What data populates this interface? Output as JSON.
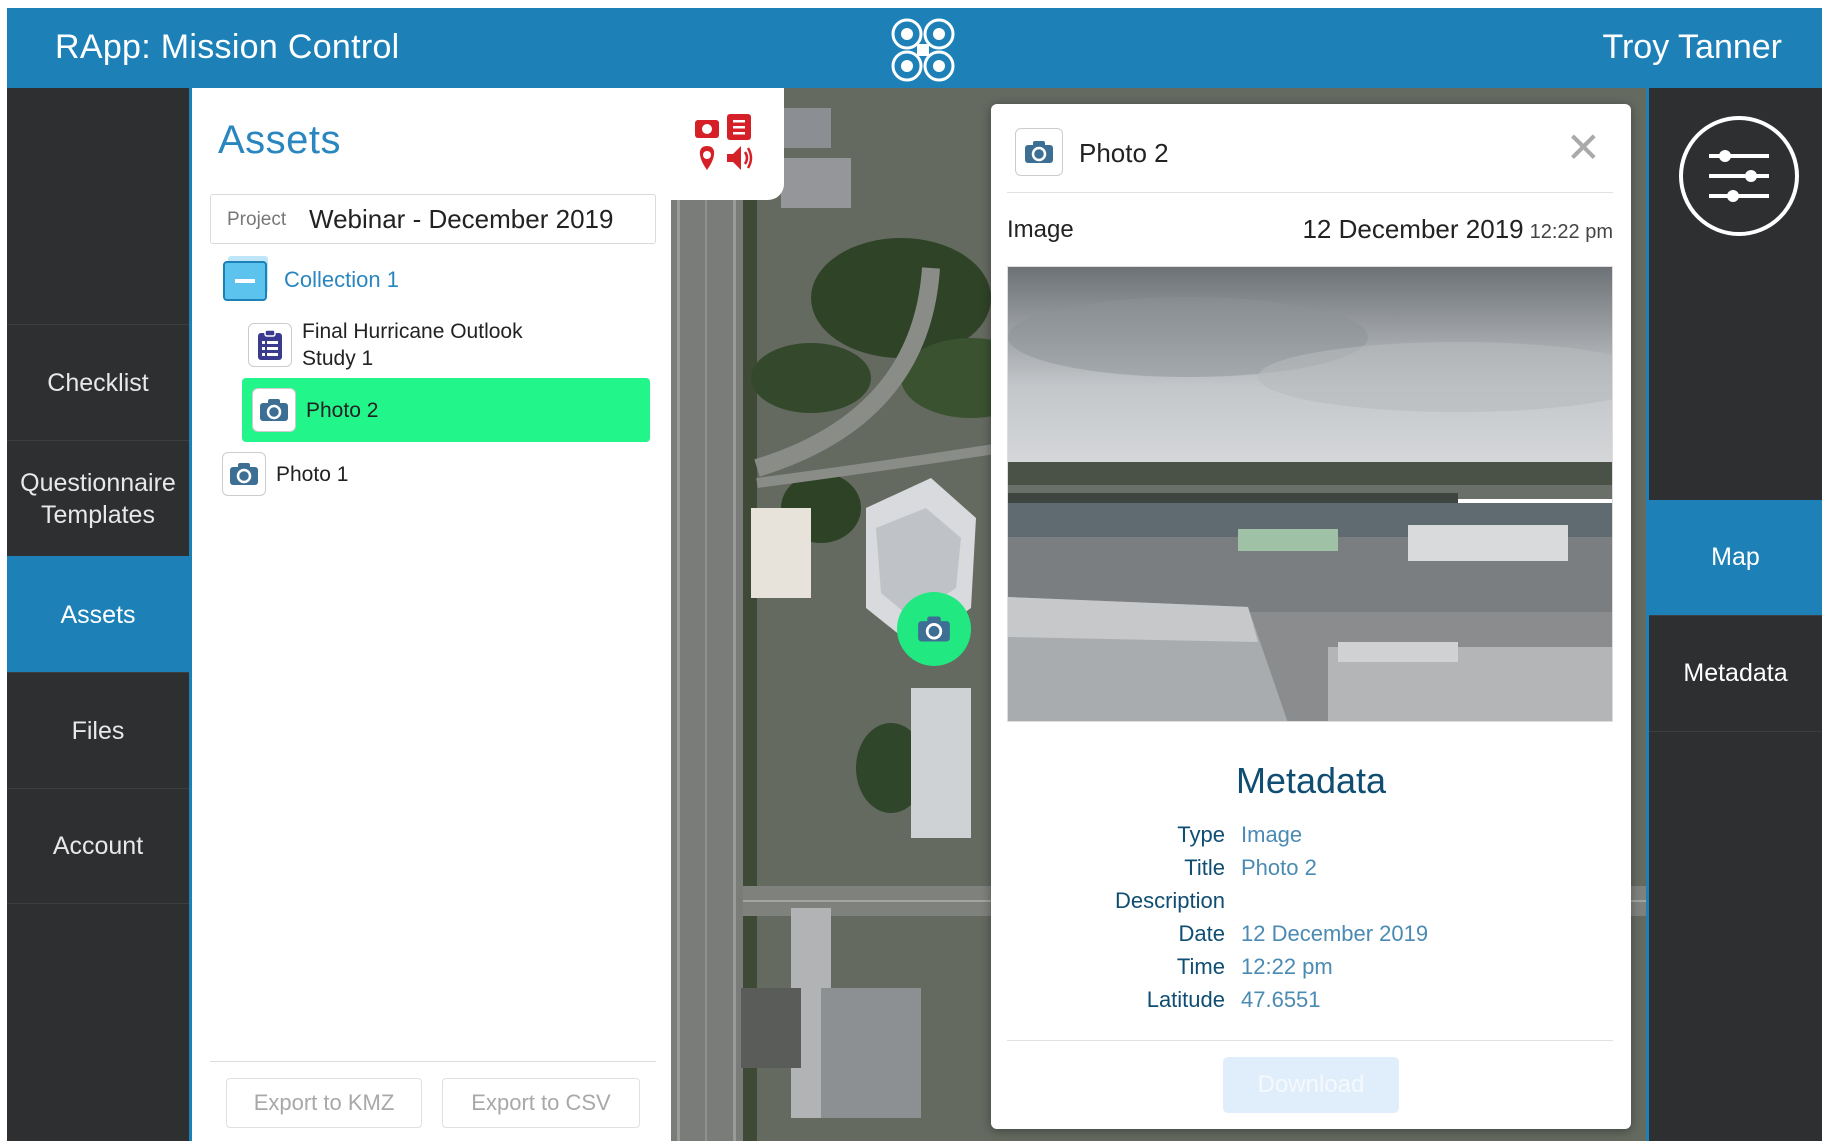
{
  "app": {
    "title": "RApp: Mission Control",
    "user": "Troy Tanner",
    "logo": "rapp-logo-icon"
  },
  "colors": {
    "header": "#1d81b8",
    "nav_bg": "#2e2f31",
    "active": "#1d81b8",
    "selected_item": "#22f58a",
    "heading": "#0f4d72"
  },
  "left_nav": {
    "items": [
      "Checklist",
      "Questionnaire Templates",
      "Assets",
      "Files",
      "Account"
    ],
    "active": "Assets"
  },
  "assets_panel": {
    "title": "Assets",
    "project_label": "Project",
    "project_value": "Webinar - December 2019",
    "tree": {
      "collection": "Collection 1",
      "checklist": "Final Hurricane Outlook Study 1",
      "photo_selected": "Photo 2",
      "photo_other": "Photo 1"
    },
    "export_kmz": "Export to KMZ",
    "export_csv": "Export to CSV"
  },
  "map": {
    "toolbox_icons": [
      "camera-icon",
      "checklist-icon",
      "location-pin-icon",
      "audio-icon"
    ],
    "pin_icon": "camera-icon"
  },
  "detail": {
    "title": "Photo 2",
    "close": "✕",
    "type": "Image",
    "date": "12 December 2019",
    "time": "12:22 pm",
    "metadata_heading": "Metadata",
    "metadata": [
      {
        "key": "Type",
        "value": "Image"
      },
      {
        "key": "Title",
        "value": "Photo 2"
      },
      {
        "key": "Description",
        "value": ""
      },
      {
        "key": "Date",
        "value": "12 December 2019"
      },
      {
        "key": "Time",
        "value": "12:22 pm"
      },
      {
        "key": "Latitude",
        "value": "47.6551"
      }
    ],
    "download": "Download"
  },
  "right_nav": {
    "filter_icon": "sliders-icon",
    "items": [
      "Map",
      "Metadata"
    ],
    "active": "Map"
  }
}
